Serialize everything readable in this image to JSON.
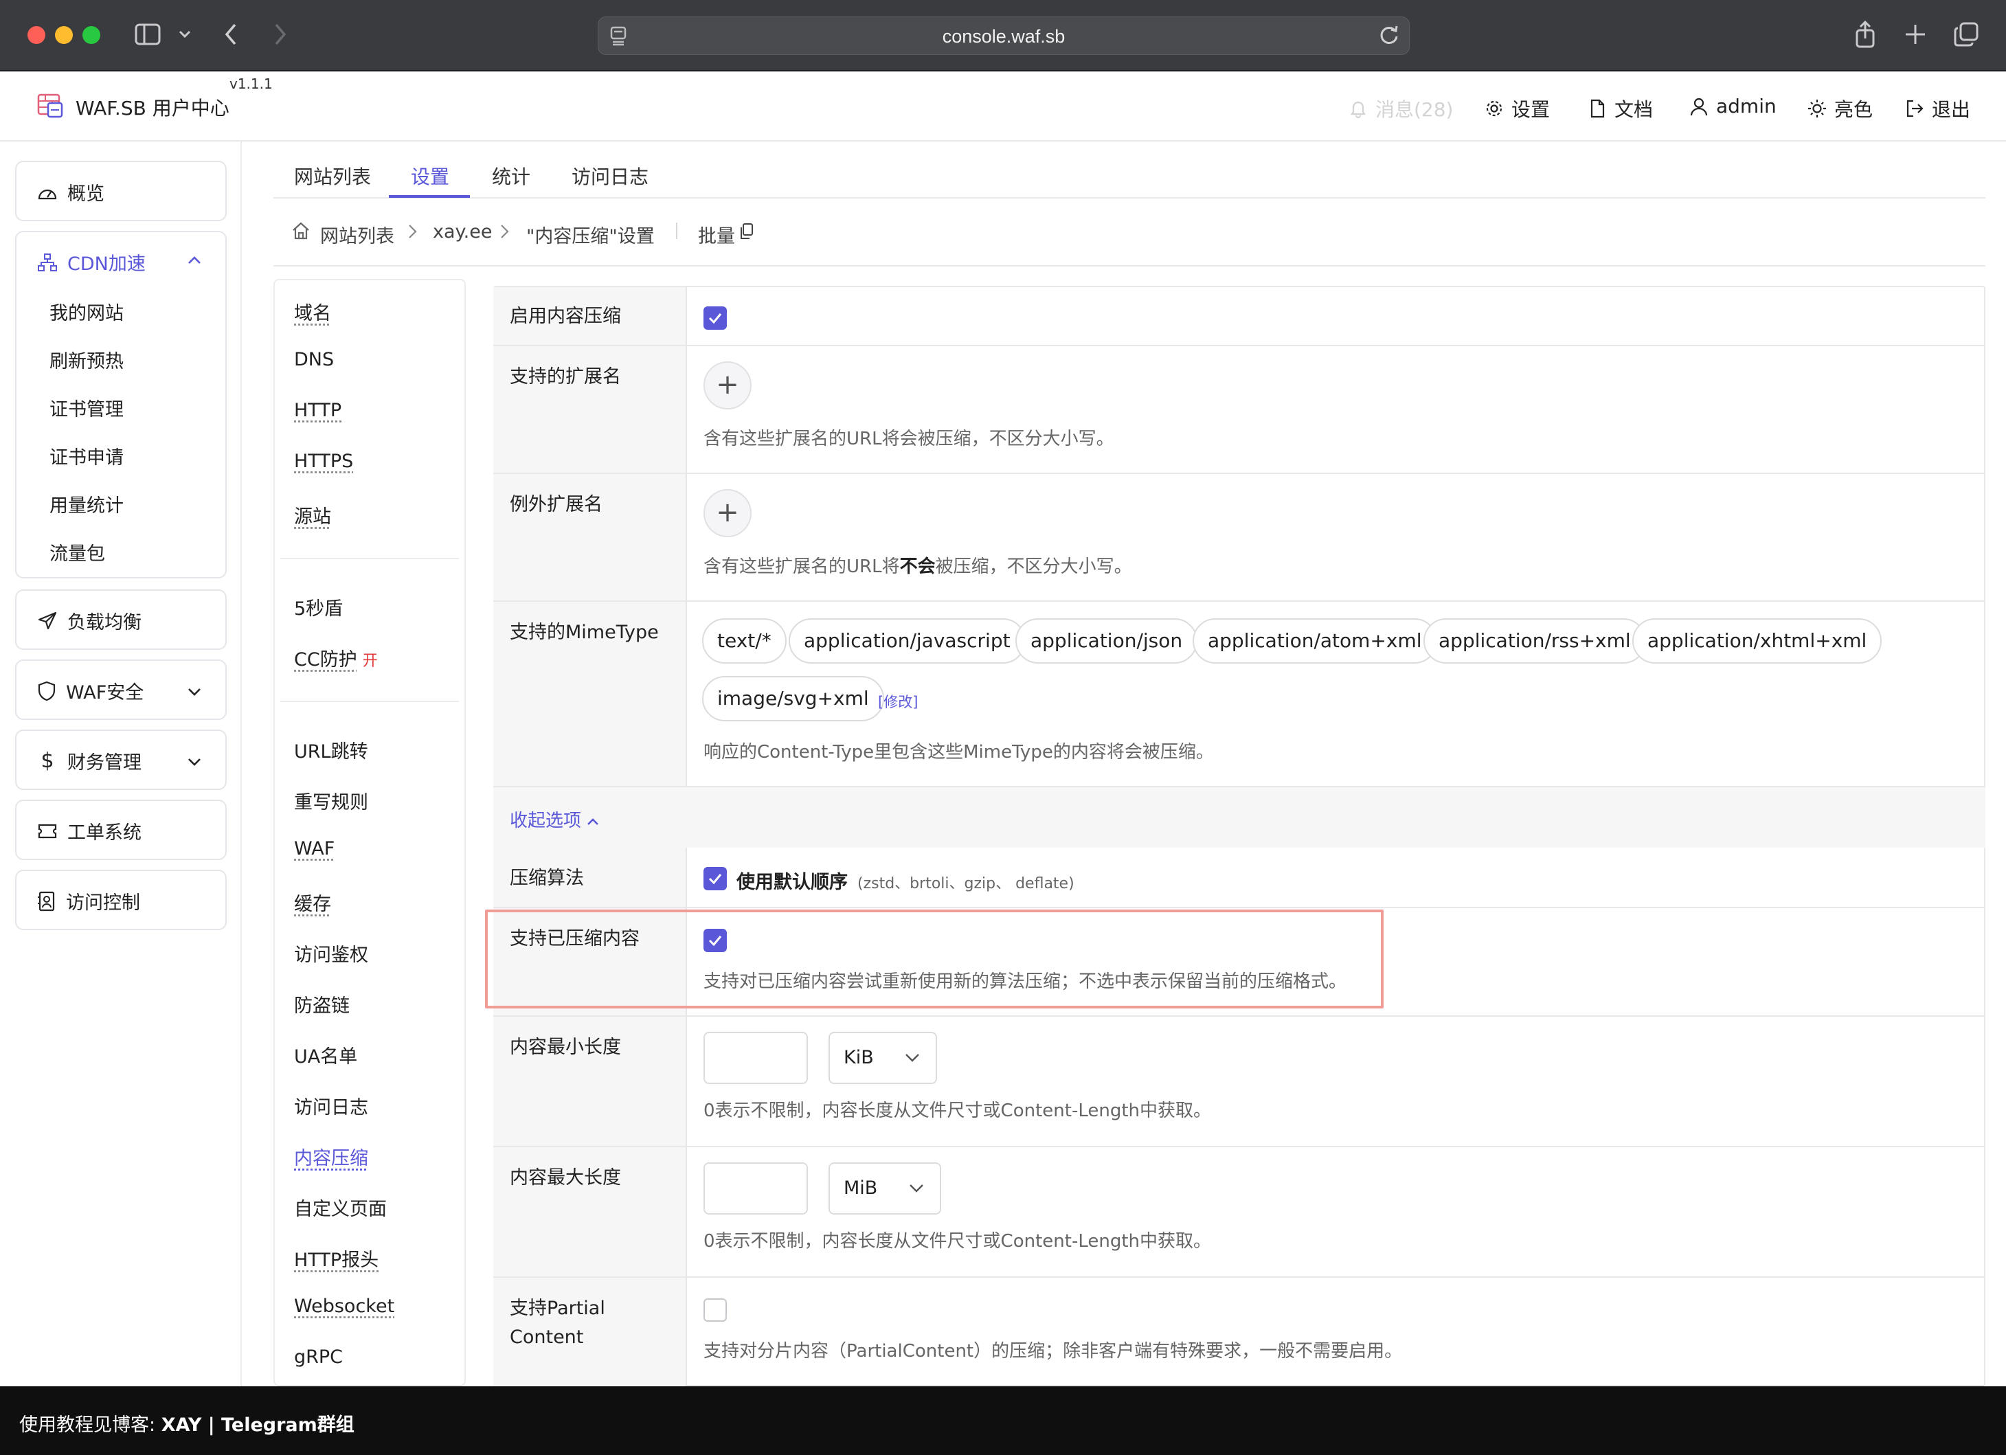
{
  "browser": {
    "url": "console.waf.sb"
  },
  "header": {
    "brand": "WAF.SB 用户中心",
    "version": "v1.1.1",
    "messages": "消息(28)",
    "settings": "设置",
    "docs": "文档",
    "user": "admin",
    "theme": "亮色",
    "logout": "退出"
  },
  "sidebar": {
    "overview": "概览",
    "cdn": "CDN加速",
    "cdn_items": [
      "我的网站",
      "刷新预热",
      "证书管理",
      "证书申请",
      "用量统计",
      "流量包"
    ],
    "load_balance": "负载均衡",
    "waf_security": "WAF安全",
    "finance": "财务管理",
    "tickets": "工单系统",
    "access_control": "访问控制"
  },
  "tabs": [
    "网站列表",
    "设置",
    "统计",
    "访问日志"
  ],
  "breadcrumb": {
    "home": "网站列表",
    "site": "xay.ee",
    "current": "\"内容压缩\"设置",
    "batch": "批量"
  },
  "settings_menu": {
    "group1": [
      "域名",
      "DNS",
      "HTTP",
      "HTTPS",
      "源站"
    ],
    "group2": [
      "5秒盾",
      "CC防护"
    ],
    "cc_badge": "开",
    "group3": [
      "URL跳转",
      "重写规则",
      "WAF",
      "缓存",
      "访问鉴权",
      "防盗链",
      "UA名单",
      "访问日志",
      "内容压缩",
      "自定义页面",
      "HTTP报头",
      "Websocket",
      "gRPC"
    ]
  },
  "form": {
    "enable_label": "启用内容压缩",
    "enable_checked": true,
    "ext_label": "支持的扩展名",
    "ext_help": "含有这些扩展名的URL将会被压缩，不区分大小写。",
    "except_label": "例外扩展名",
    "except_help_pre": "含有这些扩展名的URL将",
    "except_help_bold": "不会",
    "except_help_post": "被压缩，不区分大小写。",
    "mime_label": "支持的MimeType",
    "mime_types": [
      "text/*",
      "application/javascript",
      "application/json",
      "application/atom+xml",
      "application/rss+xml",
      "application/xhtml+xml",
      "image/svg+xml"
    ],
    "mime_modify": "[修改]",
    "mime_help": "响应的Content-Type里包含这些MimeType的内容将会被压缩。",
    "collapse": "收起选项",
    "algo_label": "压缩算法",
    "algo_checked": true,
    "algo_text": "使用默认顺序",
    "algo_hint": "(zstd、brtoli、gzip、 deflate)",
    "compressed_label": "支持已压缩内容",
    "compressed_checked": true,
    "compressed_help": "支持对已压缩内容尝试重新使用新的算法压缩；不选中表示保留当前的压缩格式。",
    "min_label": "内容最小长度",
    "min_value": "",
    "min_unit": "KiB",
    "min_help": "0表示不限制，内容长度从文件尺寸或Content-Length中获取。",
    "max_label": "内容最大长度",
    "max_value": "",
    "max_unit": "MiB",
    "max_help": "0表示不限制，内容长度从文件尺寸或Content-Length中获取。",
    "partial_label_1": "支持Partial",
    "partial_label_2": "Content",
    "partial_checked": false,
    "partial_help": "支持对分片内容（PartialContent）的压缩；除非客户端有特殊要求，一般不需要启用。"
  },
  "footer": {
    "prefix": "使用教程见博客: ",
    "blog": "XAY",
    "sep": " | ",
    "group": "Telegram群组"
  },
  "colors": {
    "accent": "#5a58d8",
    "highlight_border": "#f29c98",
    "danger": "#e23b3b"
  }
}
